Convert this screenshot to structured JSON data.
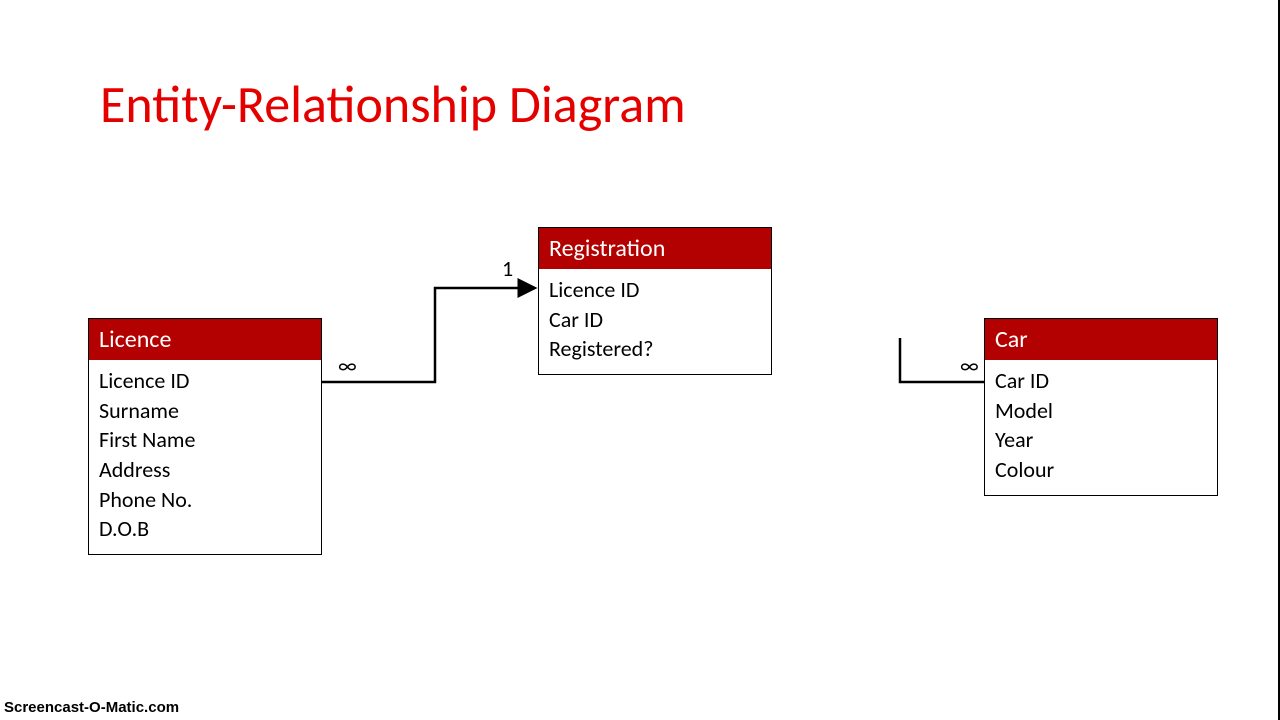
{
  "title": "Entity-Relationship Diagram",
  "entities": {
    "licence": {
      "name": "Licence",
      "attributes": [
        "Licence ID",
        "Surname",
        "First Name",
        "Address",
        "Phone No.",
        "D.O.B"
      ]
    },
    "registration": {
      "name": "Registration",
      "attributes": [
        "Licence ID",
        "Car ID",
        "Registered?"
      ]
    },
    "car": {
      "name": "Car",
      "attributes": [
        "Car ID",
        "Model",
        "Year",
        "Colour"
      ]
    }
  },
  "cardinalities": {
    "licence_side": "∞",
    "registration_side": "1",
    "car_side": "∞"
  },
  "watermark": "Screencast-O-Matic.com"
}
